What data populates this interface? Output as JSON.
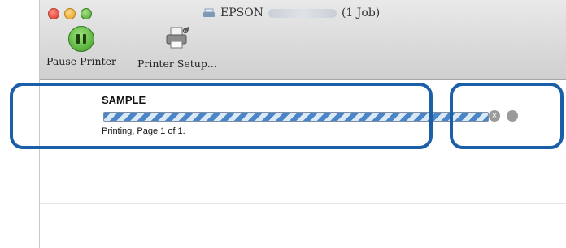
{
  "window": {
    "title_brand": "EPSON",
    "title_jobs": "(1 Job)"
  },
  "toolbar": {
    "pause_label": "Pause",
    "printer_label": "Printer",
    "setup_label": "Printer Setup..."
  },
  "job": {
    "name": "SAMPLE",
    "status": "Printing, Page 1 of 1.",
    "progress_percent": 100
  },
  "colors": {
    "highlight": "#1a5fa8",
    "progress_stripe": "#4a86c7",
    "pause_green": "#3f9b25"
  },
  "icons": {
    "pause": "pause-icon",
    "setup": "printer-setup-icon",
    "stop": "stop-icon",
    "hold": "hold-icon"
  }
}
